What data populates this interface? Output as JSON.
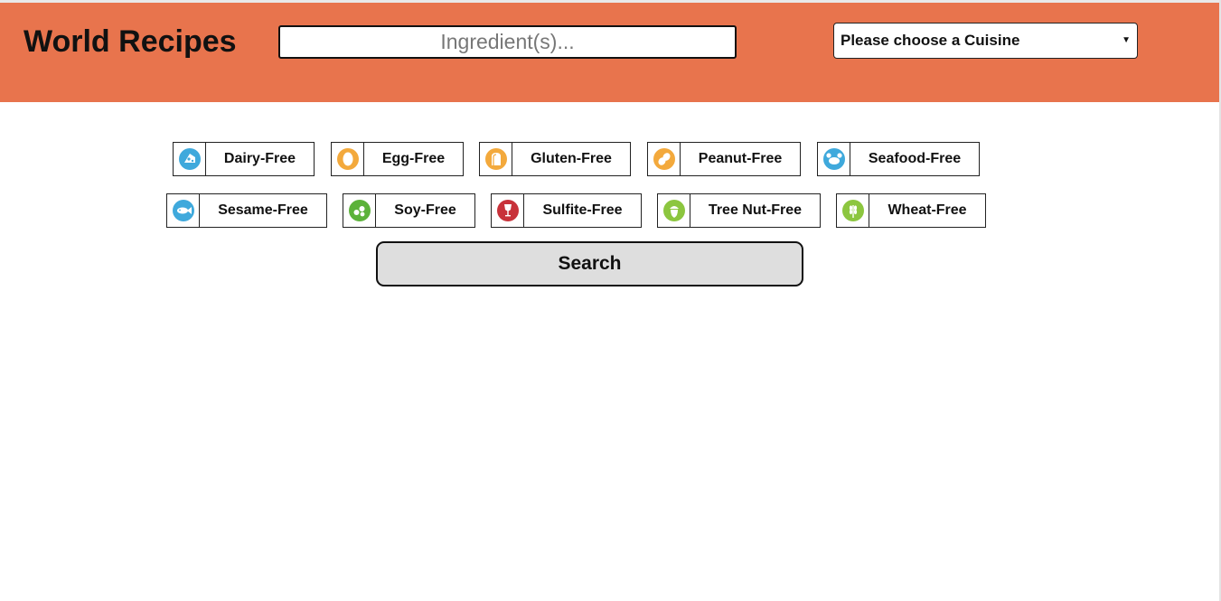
{
  "header": {
    "title": "World Recipes",
    "ingredient_placeholder": "Ingredient(s)...",
    "ingredient_value": "",
    "cuisine_selected": "Please choose a Cuisine",
    "background_color": "#e8744d"
  },
  "filters": [
    {
      "label": "Dairy-Free",
      "icon": "cheese-icon",
      "color": "#3fa9dc"
    },
    {
      "label": "Egg-Free",
      "icon": "egg-icon",
      "color": "#f3a93c"
    },
    {
      "label": "Gluten-Free",
      "icon": "bread-icon",
      "color": "#f3a93c"
    },
    {
      "label": "Peanut-Free",
      "icon": "peanut-icon",
      "color": "#f3a93c"
    },
    {
      "label": "Seafood-Free",
      "icon": "crab-icon",
      "color": "#3fa9dc"
    },
    {
      "label": "Sesame-Free",
      "icon": "fish-icon",
      "color": "#3fa9dc"
    },
    {
      "label": "Soy-Free",
      "icon": "soy-icon",
      "color": "#5cb23a"
    },
    {
      "label": "Sulfite-Free",
      "icon": "wine-glass-icon",
      "color": "#c8323a"
    },
    {
      "label": "Tree Nut-Free",
      "icon": "acorn-icon",
      "color": "#8cc63f"
    },
    {
      "label": "Wheat-Free",
      "icon": "wheat-icon",
      "color": "#8cc63f"
    }
  ],
  "search": {
    "label": "Search"
  }
}
